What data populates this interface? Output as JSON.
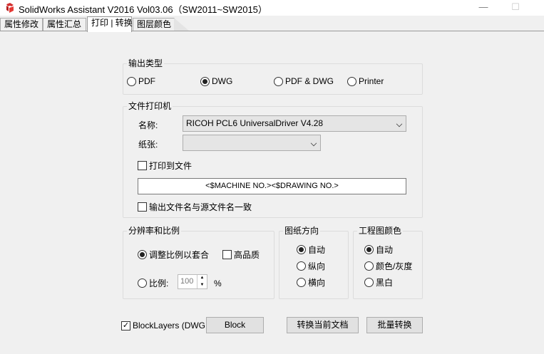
{
  "window": {
    "title": "SolidWorks Assistant V2016 Vol03.06（SW2011~SW2015）",
    "minimize_glyph": "—",
    "maximize_glyph": "☐"
  },
  "tabs": [
    {
      "label": "属性修改",
      "active": false
    },
    {
      "label": "属性汇总",
      "active": false
    },
    {
      "label": "打印 | 转换",
      "active": true
    },
    {
      "label": "图层颜色",
      "active": false
    }
  ],
  "output_type": {
    "title": "输出类型",
    "options": [
      "PDF",
      "DWG",
      "PDF & DWG",
      "Printer"
    ],
    "selected": "DWG"
  },
  "file_printer": {
    "title": "文件打印机",
    "name_label": "名称:",
    "name_value": "RICOH PCL6 UniversalDriver V4.28",
    "paper_label": "纸张:",
    "paper_value": "",
    "print_to_file_label": "打印到文件",
    "print_to_file_checked": false,
    "filename_pattern": "<$MACHINE NO.><$DRAWING NO.>",
    "match_source_label": "输出文件名与源文件名一致",
    "match_source_checked": false
  },
  "resolution": {
    "title": "分辨率和比例",
    "fit_label": "调整比例以套合",
    "fit_selected": true,
    "high_quality_label": "高品质",
    "high_quality_checked": false,
    "scale_label": "比例:",
    "scale_value": "100",
    "scale_unit": "%"
  },
  "orientation": {
    "title": "图纸方向",
    "options": [
      "自动",
      "纵向",
      "横向"
    ],
    "selected": "自动"
  },
  "drawing_color": {
    "title": "工程图颜色",
    "options": [
      "自动",
      "颜色/灰度",
      "黑白"
    ],
    "selected": "自动"
  },
  "bottom": {
    "block_layers_label": "BlockLayers (DWG",
    "block_layers_checked": true,
    "block_button": "Block",
    "convert_current_button": "转换当前文档",
    "batch_convert_button": "批量转换"
  },
  "colors": {
    "app_icon_red": "#d32f2f",
    "panel_bg": "#f0f0f0",
    "group_border": "#dcdcdc"
  }
}
